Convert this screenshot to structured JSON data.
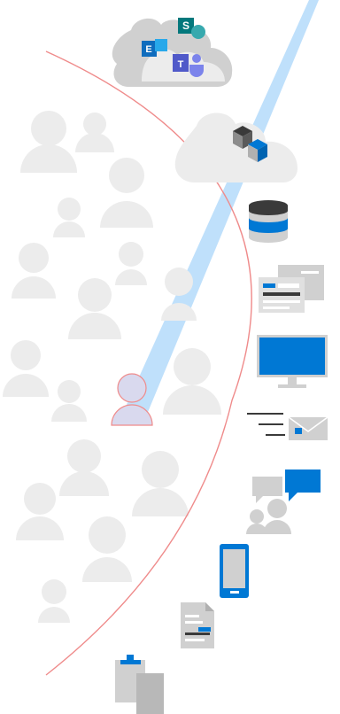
{
  "cloud_apps": {
    "sharepoint_letter": "S",
    "exchange_letter": "E",
    "teams_letter": "T"
  },
  "icons": [
    "cloud-apps-icon",
    "cloud-containers-icon",
    "database-icon",
    "documents-icon",
    "monitor-icon",
    "email-icon",
    "chat-users-icon",
    "mobile-phone-icon",
    "file-icon",
    "clipboard-icon"
  ],
  "colors": {
    "beam": "#bfe0fb",
    "boundary_arc": "#ef8b8b",
    "highlighted_user": "#d9d9ee",
    "crowd": "#ececec",
    "accent_blue": "#0078d4",
    "gray_icon": "#d0d0d0",
    "dark_gray": "#3a3a3a",
    "sharepoint": "#03787c",
    "exchange": "#0f6cbd",
    "teams": "#5059c9"
  }
}
